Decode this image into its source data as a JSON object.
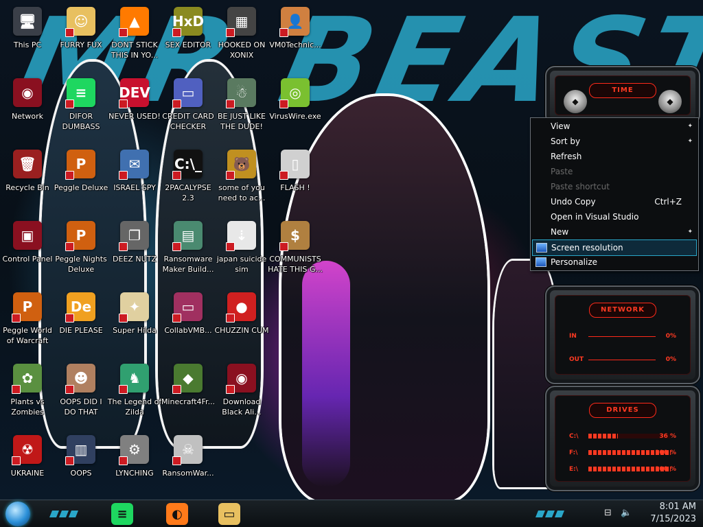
{
  "background": {
    "wallpaper_text": "MR BEAST"
  },
  "desktop_icons": [
    {
      "label": "This PC",
      "glyph": "🖥",
      "color": "#3a3f48"
    },
    {
      "label": "FURRY FUX",
      "glyph": "☺",
      "color": "#e8c060"
    },
    {
      "label": "DONT STICK THIS IN YO...",
      "glyph": "▲",
      "color": "#ff7a00"
    },
    {
      "label": "SEX EDITOR",
      "glyph": "HxD",
      "color": "#8a8a20"
    },
    {
      "label": "HOOKED ON XONIX",
      "glyph": "▦",
      "color": "#444"
    },
    {
      "label": "VM0Technic...",
      "glyph": "👤",
      "color": "#d08040"
    },
    {
      "label": "Network",
      "glyph": "◉",
      "color": "#8a1020"
    },
    {
      "label": "DIFOR DUMBASS",
      "glyph": "≡",
      "color": "#1ed760"
    },
    {
      "label": "NEVER USED!",
      "glyph": "DEV",
      "color": "#c8102e"
    },
    {
      "label": "CREDIT CARD CHECKER",
      "glyph": "▭",
      "color": "#5060c0"
    },
    {
      "label": "BE JUST LIKE THE DUDE!",
      "glyph": "☃",
      "color": "#5a7a60"
    },
    {
      "label": "VirusWire.exe",
      "glyph": "◎",
      "color": "#7ac030"
    },
    {
      "label": "Recycle Bin",
      "glyph": "🗑",
      "color": "#9a2020"
    },
    {
      "label": "Peggle Deluxe",
      "glyph": "P",
      "color": "#d06010"
    },
    {
      "label": "ISRAEL SPY",
      "glyph": "✉",
      "color": "#4070b0"
    },
    {
      "label": "2PACALYPSE 2.3",
      "glyph": "C:\\_",
      "color": "#111"
    },
    {
      "label": "some of you need to ac...",
      "glyph": "🐻",
      "color": "#c09020"
    },
    {
      "label": "FLASH !",
      "glyph": "▯",
      "color": "#d0d0d0"
    },
    {
      "label": "Control Panel",
      "glyph": "▣",
      "color": "#8a1020"
    },
    {
      "label": "Peggle Nights Deluxe",
      "glyph": "P",
      "color": "#d06010"
    },
    {
      "label": "DEEZ NUTZ",
      "glyph": "❐",
      "color": "#666"
    },
    {
      "label": "Ransomware Maker Build...",
      "glyph": "▤",
      "color": "#4a8a70"
    },
    {
      "label": "japan suicide sim",
      "glyph": "⇣",
      "color": "#e8e8e8"
    },
    {
      "label": "COMMUNISTS HATE THIS G...",
      "glyph": "$",
      "color": "#b08040"
    },
    {
      "label": "Peggle World of Warcraft",
      "glyph": "P",
      "color": "#d06010"
    },
    {
      "label": "DIE PLEASE",
      "glyph": "De",
      "color": "#f0a020"
    },
    {
      "label": "Super Hilda",
      "glyph": "✦",
      "color": "#e0d0a0"
    },
    {
      "label": "CollabVMB...",
      "glyph": "▭",
      "color": "#a03060"
    },
    {
      "label": "CHUZZIN CUM",
      "glyph": "●",
      "color": "#d02020"
    },
    {
      "label": "Plants vs Zombies",
      "glyph": "✿",
      "color": "#5a9040"
    },
    {
      "label": "OOPS DID I DO THAT",
      "glyph": "☻",
      "color": "#b08060"
    },
    {
      "label": "The Legend of Zilda",
      "glyph": "♞",
      "color": "#30a070"
    },
    {
      "label": "Minecraft4Fr...",
      "glyph": "◆",
      "color": "#4a7a30"
    },
    {
      "label": "Download Black Ali...",
      "glyph": "◉",
      "color": "#8a1020"
    },
    {
      "label": "UKRAINE",
      "glyph": "☢",
      "color": "#c01818"
    },
    {
      "label": "OOPS",
      "glyph": "▥",
      "color": "#304060"
    },
    {
      "label": "LYNCHING",
      "glyph": "⚙",
      "color": "#808080"
    },
    {
      "label": "RansomWar...",
      "glyph": "☠",
      "color": "#c0c0c0"
    }
  ],
  "gadgets": {
    "time": {
      "title": "TIME"
    },
    "network": {
      "title": "NETWORK",
      "rows": [
        {
          "label": "IN",
          "value": "0%"
        },
        {
          "label": "OUT",
          "value": "0%"
        }
      ]
    },
    "drives": {
      "title": "DRIVES",
      "rows": [
        {
          "label": "C:\\",
          "value": "36 %",
          "fraction": 0.36
        },
        {
          "label": "F:\\",
          "value": "100 %",
          "fraction": 1.0
        },
        {
          "label": "E:\\",
          "value": "100 %",
          "fraction": 1.0
        }
      ]
    }
  },
  "context_menu": {
    "items": [
      {
        "label": "View",
        "accel": "",
        "submenu": true,
        "disabled": false,
        "icon": false
      },
      {
        "label": "Sort by",
        "accel": "",
        "submenu": true,
        "disabled": false,
        "icon": false
      },
      {
        "label": "Refresh",
        "accel": "",
        "submenu": false,
        "disabled": false,
        "icon": false
      },
      {
        "label": "Paste",
        "accel": "",
        "submenu": false,
        "disabled": true,
        "icon": false
      },
      {
        "label": "Paste shortcut",
        "accel": "",
        "submenu": false,
        "disabled": true,
        "icon": false
      },
      {
        "label": "Undo Copy",
        "accel": "Ctrl+Z",
        "submenu": false,
        "disabled": false,
        "icon": false
      },
      {
        "label": "Open in Visual Studio",
        "accel": "",
        "submenu": false,
        "disabled": false,
        "icon": false
      },
      {
        "label": "New",
        "accel": "",
        "submenu": true,
        "disabled": false,
        "icon": false
      },
      {
        "label": "Screen resolution",
        "accel": "",
        "submenu": false,
        "disabled": false,
        "icon": true,
        "hover": true
      },
      {
        "label": "Personalize",
        "accel": "",
        "submenu": false,
        "disabled": false,
        "icon": true
      }
    ]
  },
  "taskbar": {
    "apps": [
      {
        "name": "spotify-icon",
        "glyph": "≡",
        "color": "#1ed760"
      },
      {
        "name": "firefox-icon",
        "glyph": "◐",
        "color": "#ff7a1a"
      },
      {
        "name": "file-explorer-icon",
        "glyph": "▭",
        "color": "#e8c060"
      }
    ],
    "clock": {
      "time": "8:01 AM",
      "date": "7/15/2023"
    }
  }
}
